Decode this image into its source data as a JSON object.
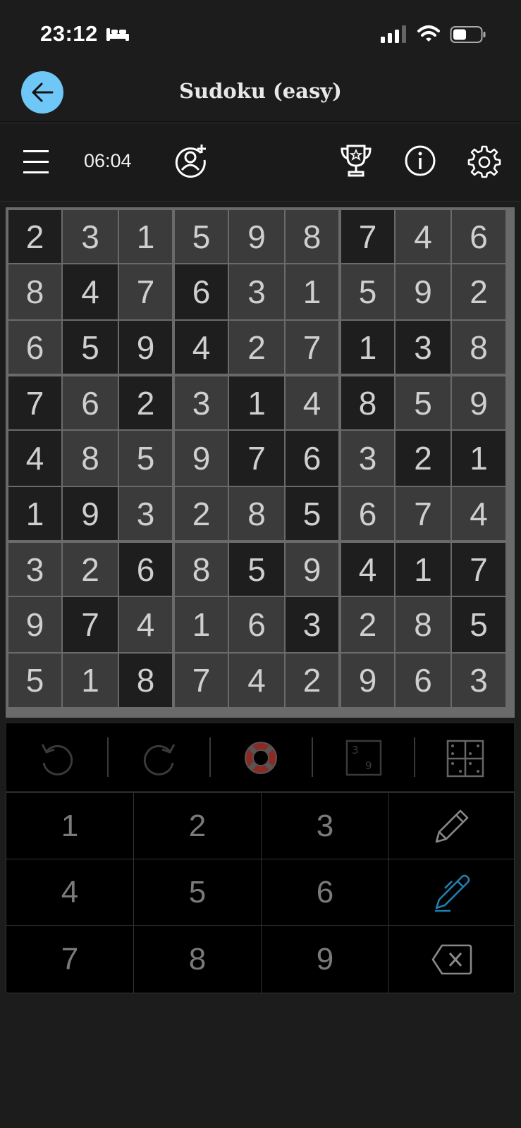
{
  "status": {
    "time": "23:12"
  },
  "nav": {
    "title": "Sudoku (easy)"
  },
  "toolbar": {
    "timer": "06:04"
  },
  "board": {
    "rows": [
      [
        2,
        3,
        1,
        5,
        9,
        8,
        7,
        4,
        6
      ],
      [
        8,
        4,
        7,
        6,
        3,
        1,
        5,
        9,
        2
      ],
      [
        6,
        5,
        9,
        4,
        2,
        7,
        1,
        3,
        8
      ],
      [
        7,
        6,
        2,
        3,
        1,
        4,
        8,
        5,
        9
      ],
      [
        4,
        8,
        5,
        9,
        7,
        6,
        3,
        2,
        1
      ],
      [
        1,
        9,
        3,
        2,
        8,
        5,
        6,
        7,
        4
      ],
      [
        3,
        2,
        6,
        8,
        5,
        9,
        4,
        1,
        7
      ],
      [
        9,
        7,
        4,
        1,
        6,
        3,
        2,
        8,
        5
      ],
      [
        5,
        1,
        8,
        7,
        4,
        2,
        9,
        6,
        3
      ]
    ],
    "dark_cells": [
      [
        0,
        0
      ],
      [
        0,
        6
      ],
      [
        1,
        1
      ],
      [
        1,
        3
      ],
      [
        2,
        1
      ],
      [
        2,
        2
      ],
      [
        2,
        3
      ],
      [
        2,
        6
      ],
      [
        2,
        7
      ],
      [
        3,
        0
      ],
      [
        3,
        2
      ],
      [
        3,
        4
      ],
      [
        3,
        6
      ],
      [
        4,
        0
      ],
      [
        4,
        4
      ],
      [
        4,
        5
      ],
      [
        4,
        7
      ],
      [
        4,
        8
      ],
      [
        5,
        0
      ],
      [
        5,
        1
      ],
      [
        5,
        5
      ],
      [
        6,
        2
      ],
      [
        6,
        4
      ],
      [
        6,
        6
      ],
      [
        6,
        7
      ],
      [
        6,
        8
      ],
      [
        7,
        1
      ],
      [
        7,
        5
      ],
      [
        7,
        8
      ],
      [
        8,
        2
      ]
    ],
    "colors": {
      "dark": "#1e1e1e",
      "light": "#3b3b3b",
      "digit": "#cfcfcf"
    }
  },
  "actions": [
    "undo-icon",
    "redo-icon",
    "hint-lifebuoy-icon",
    "candidates-icon",
    "grid-notes-icon"
  ],
  "keypad": {
    "digits": [
      "1",
      "2",
      "3",
      "4",
      "5",
      "6",
      "7",
      "8",
      "9"
    ],
    "tools": [
      "pencil-icon",
      "pen-icon",
      "delete-icon"
    ],
    "accent": "#1f7fb0"
  },
  "colors": {
    "back_button": "#6fc7f7",
    "background": "#1c1c1c"
  }
}
